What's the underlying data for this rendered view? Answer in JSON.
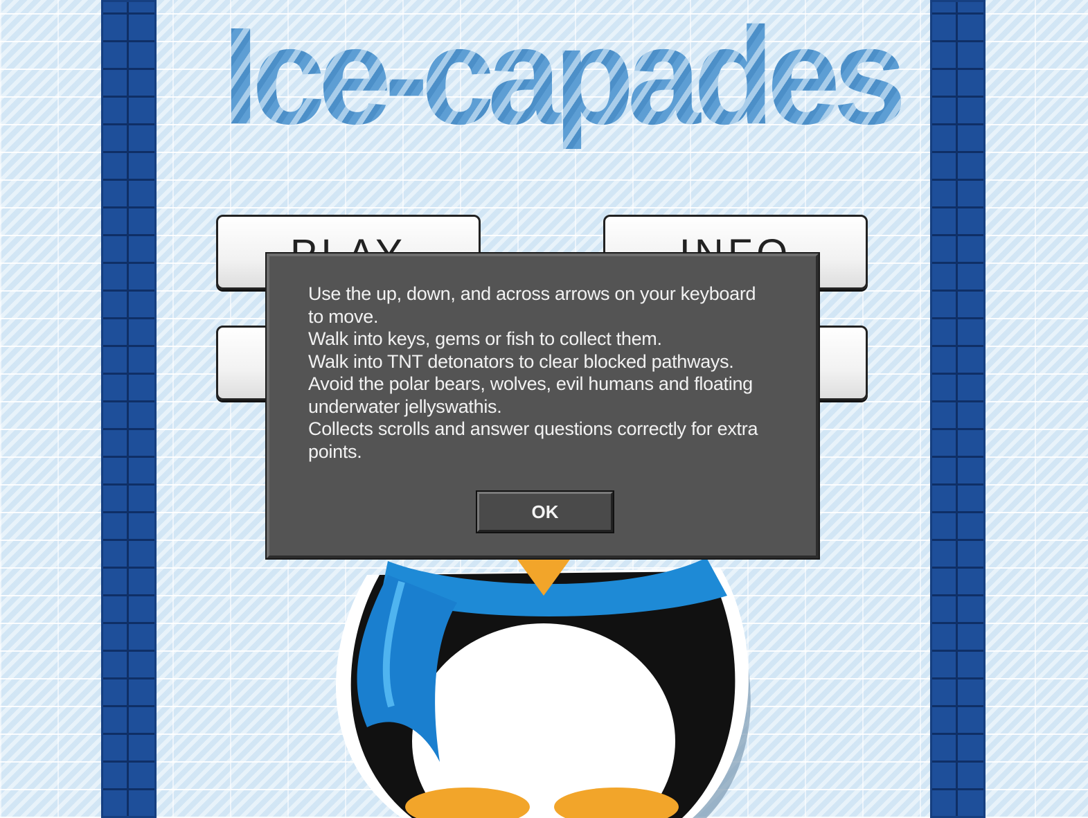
{
  "game": {
    "title": "Ice-capades",
    "menu": [
      {
        "label": "PLAY"
      },
      {
        "label": "INFO"
      },
      {
        "label": ""
      },
      {
        "label": ""
      }
    ]
  },
  "dialog": {
    "lines": [
      "Use the up, down, and across arrows on your keyboard",
      "to move.",
      "Walk into keys, gems or fish to collect them.",
      "Walk into TNT detonators to clear blocked pathways.",
      "Avoid the polar bears, wolves, evil humans and floating",
      "underwater jellyswathis.",
      "Collects scrolls and answer questions correctly for extra",
      "points."
    ],
    "ok_label": "OK"
  },
  "colors": {
    "background": "#dcecf8",
    "pillar": "#1e4f9a",
    "dialog_bg": "#545454",
    "penguin_scarf": "#1e8ad6",
    "penguin_beak": "#f2a52a"
  }
}
